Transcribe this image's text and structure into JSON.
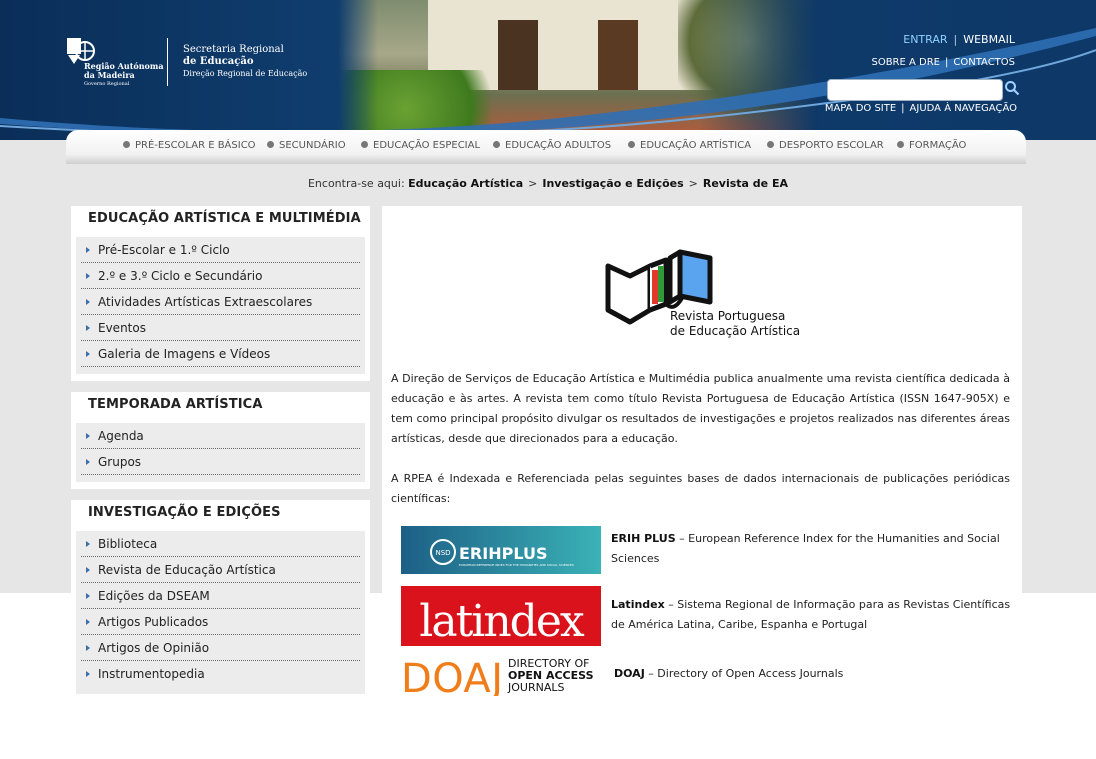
{
  "header": {
    "logo_line1": "Região Autónoma",
    "logo_line2": "da Madeira",
    "logo_line3": "Governo Regional",
    "secretaria_line1": "Secretaria Regional",
    "secretaria_line2": "de Educação",
    "secretaria_line3": "Direção Regional de Educação",
    "links_top": [
      "ENTRAR",
      "WEBMAIL"
    ],
    "links_mid": [
      "SOBRE A DRE",
      "CONTACTOS"
    ],
    "links_bottom": [
      "MAPA DO SITE",
      "AJUDA À NAVEGAÇÃO"
    ],
    "search_placeholder": ""
  },
  "nav": [
    "PRÉ-ESCOLAR E BÁSICO",
    "SECUNDÁRIO",
    "EDUCAÇÃO ESPECIAL",
    "EDUCAÇÃO ADULTOS",
    "EDUCAÇÃO ARTÍSTICA",
    "DESPORTO ESCOLAR",
    "FORMAÇÃO"
  ],
  "breadcrumb": {
    "prefix": "Encontra-se aqui:",
    "items": [
      "Educação Artística",
      "Investigação e Edições",
      "Revista de EA"
    ],
    "sep": ">"
  },
  "sidebar": [
    {
      "title": "EDUCAÇÃO ARTÍSTICA E MULTIMÉDIA",
      "items": [
        "Pré-Escolar e 1.º Ciclo",
        "2.º e 3.º Ciclo e Secundário",
        "Atividades Artísticas Extraescolares",
        "Eventos",
        "Galeria de Imagens e Vídeos"
      ]
    },
    {
      "title": "TEMPORADA ARTÍSTICA",
      "items": [
        "Agenda",
        "Grupos"
      ]
    },
    {
      "title": "INVESTIGAÇÃO E EDIÇÕES",
      "items": [
        "Biblioteca",
        "Revista de Educação Artística",
        "Edições da DSEAM",
        "Artigos Publicados",
        "Artigos de Opinião",
        "Instrumentopedia"
      ]
    }
  ],
  "main": {
    "logo_line1": "Revista Portuguesa",
    "logo_line2": "de Educação Artística",
    "para1": "A Direção de Serviços de Educação Artística e Multimédia publica anualmente uma revista científica dedicada à educação e às artes. A revista tem como título Revista Portuguesa de Educação Artística (ISSN 1647-905X) e tem como principal propósito divulgar os resultados de investigações e projetos realizados nas diferentes áreas artísticas, desde que direcionados para a educação.",
    "para2": "A RPEA é Indexada e Referenciada pelas seguintes bases de dados internacionais de publicações periódicas científicas:",
    "databases": [
      {
        "name": "ERIH PLUS",
        "desc": " – European Reference Index for the Humanities and Social Sciences",
        "logo_text": "ERIHPLUS",
        "logo_badge": "NSD",
        "logo_sub": "EUROPEAN REFERENCE INDEX FOR THE HUMANITIES AND SOCIAL SCIENCES"
      },
      {
        "name": "Latindex",
        "desc": " – Sistema Regional de Informação para as Revistas Científicas de América Latina, Caribe, Espanha e Portugal",
        "logo_text": "latindex"
      },
      {
        "name": "DOAJ",
        "desc": " – Directory of Open Access Journals",
        "logo_text": "DOAJ",
        "logo_sub": [
          "DIRECTORY OF",
          "OPEN ACCESS",
          "JOURNALS"
        ]
      }
    ]
  },
  "colors": {
    "header_blue": "#0f3d6e",
    "link_highlight": "#8fd0ff",
    "bullet_blue": "#3a6fa8",
    "latindex_red": "#d9121b",
    "doaj_orange": "#f07d1a",
    "erih_teal": "#2a8a9a"
  }
}
